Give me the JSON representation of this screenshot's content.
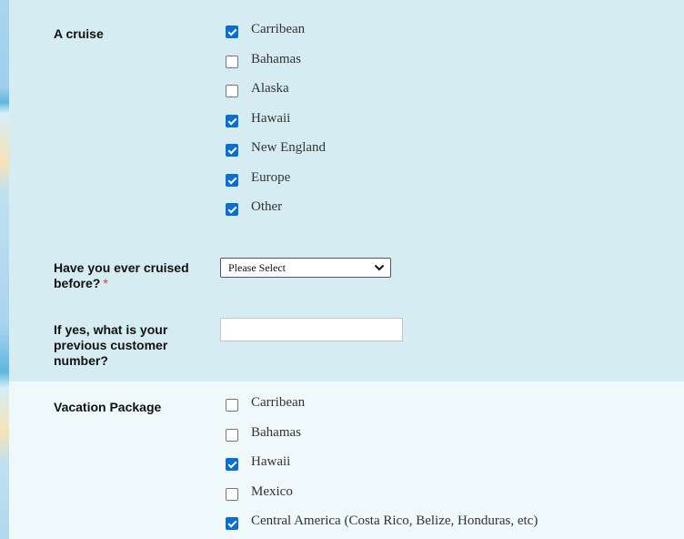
{
  "cruise": {
    "label": "A cruise",
    "options": [
      {
        "label": "Carribean",
        "checked": true
      },
      {
        "label": "Bahamas",
        "checked": false
      },
      {
        "label": "Alaska",
        "checked": false
      },
      {
        "label": "Hawaii",
        "checked": true
      },
      {
        "label": "New England",
        "checked": true
      },
      {
        "label": "Europe",
        "checked": true
      },
      {
        "label": "Other",
        "checked": true
      }
    ]
  },
  "cruised_before": {
    "label_line1": "Have you ever cruised",
    "label_line2": "before?",
    "required_mark": "*",
    "select_value": "Please Select"
  },
  "customer_number": {
    "label_line1": "If yes, what is your",
    "label_line2": "previous customer",
    "label_line3": "number?",
    "value": ""
  },
  "vacation_package": {
    "label": "Vacation Package",
    "options": [
      {
        "label": "Carribean",
        "checked": false
      },
      {
        "label": "Bahamas",
        "checked": false
      },
      {
        "label": "Hawaii",
        "checked": true
      },
      {
        "label": "Mexico",
        "checked": false
      },
      {
        "label": "Central America (Costa Rico, Belize, Honduras, etc)",
        "checked": true
      }
    ]
  },
  "colors": {
    "panel_primary": "#d5ecf2",
    "panel_secondary": "#eff8fa",
    "checkbox_checked": "#0b6fd1",
    "required": "#d43b3b"
  }
}
